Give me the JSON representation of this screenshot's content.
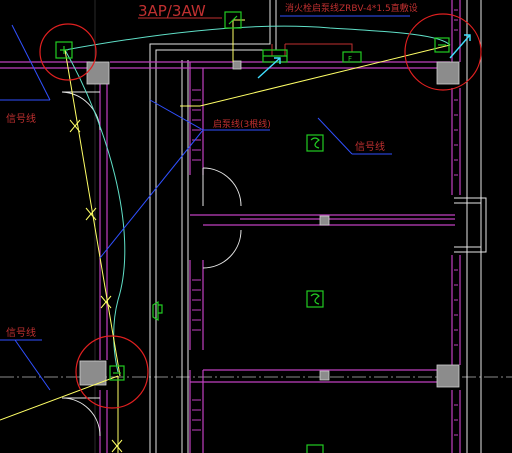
{
  "drawing": {
    "panel_label": "3AP/3AW",
    "annotations": {
      "top_feed": "消火栓启泵线ZRBV-4*1.5直敷设",
      "pump_line": "启泵线(3根线)",
      "signal_left_top": "信号线",
      "signal_right": "信号线",
      "signal_left_bottom": "信号线"
    },
    "device_labels": {
      "junction_box": "F"
    }
  },
  "colors": {
    "background": "#000000",
    "wall": "#c040c0",
    "annotation": "#c03030",
    "signal_line": "#ffff66",
    "pump_line": "#60e0c8",
    "device": "#22cc22",
    "leader": "#3050ff",
    "circle": "#e02020",
    "column": "#8c8c8c"
  }
}
